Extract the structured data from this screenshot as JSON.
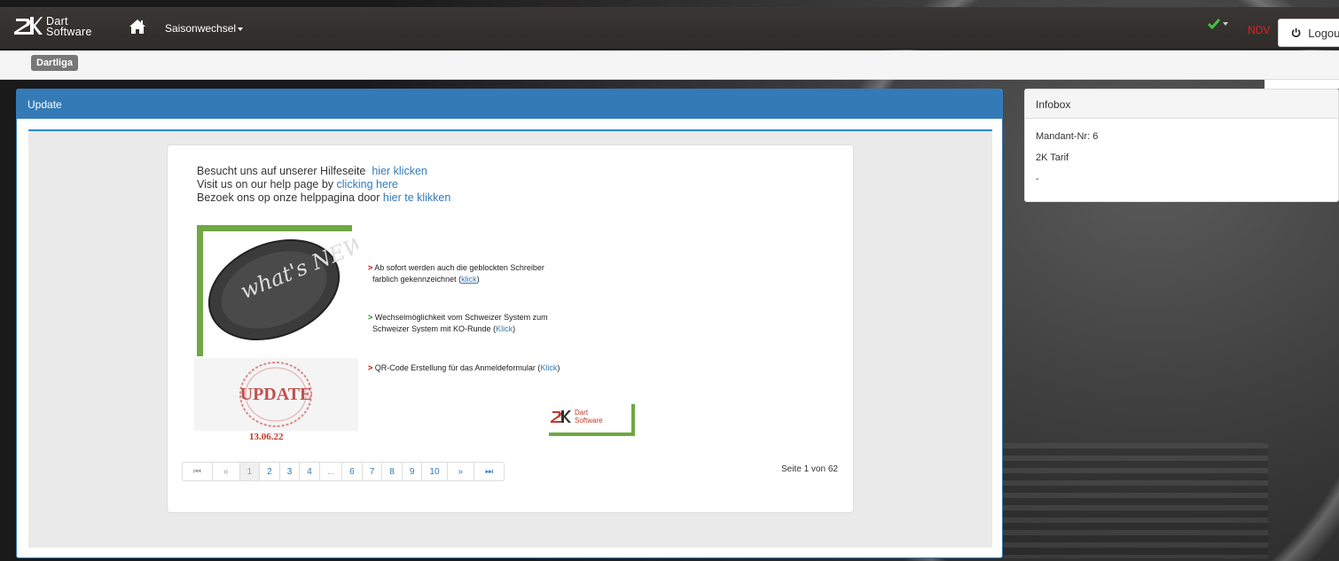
{
  "navbar": {
    "brand_line1": "Dart",
    "brand_line2": "Software",
    "season_label": "Saisonwechsel",
    "ndv_label": "NDV",
    "logout_label": "Logout"
  },
  "breadcrumb": {
    "label": "Dartliga"
  },
  "panel": {
    "title": "Update",
    "help": {
      "line1_text": "Besucht uns auf unserer Hilfeseite",
      "line1_link": "hier klicken",
      "line2_text": "Visit us on our help page by",
      "line2_link": "clicking here",
      "line3_text": "Bezoek ons op onze helppagina door",
      "line3_link": "hier te klikken"
    },
    "whats_new_text": "what's NEW",
    "update_stamp_text": "UPDATE",
    "update_date": "13.06.22",
    "news": [
      {
        "marker": ">",
        "line1": "Ab sofort werden auch die geblockten Schreiber",
        "line2": "farblich gekennzeichnet",
        "link": "klick"
      },
      {
        "marker": ">",
        "line1": "Wechselmöglichkeit vom Schweizer System zum",
        "line2": "Schweizer System mit KO-Runde",
        "link": "Klick"
      },
      {
        "marker": ">",
        "line1": "QR-Code Erstellung für das Anmeldeformular",
        "link": "Klick"
      }
    ],
    "logo_line1": "Dart",
    "logo_line2": "Software",
    "pagination": {
      "first": "⏮",
      "prev": "«",
      "pages": [
        "1",
        "2",
        "3",
        "4",
        "...",
        "6",
        "7",
        "8",
        "9",
        "10"
      ],
      "next": "»",
      "last": "⏭",
      "active_page": "1"
    },
    "page_info": "Seite 1 von 62"
  },
  "infobox": {
    "title": "Infobox",
    "mandant": "Mandant-Nr: 6",
    "tarif": "2K Tarif",
    "extra": "-"
  },
  "colors": {
    "primary": "#337ab7",
    "ndv": "#e02020",
    "check": "#3ec33e",
    "green_frame": "#6fa844"
  }
}
